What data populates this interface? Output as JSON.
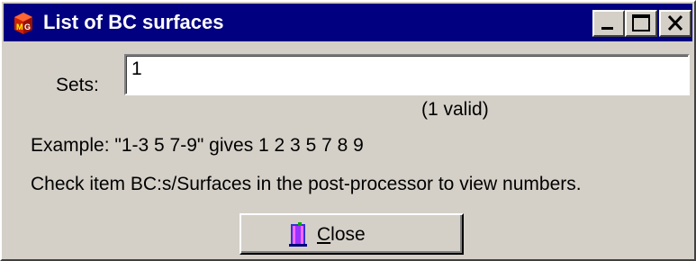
{
  "window": {
    "title": "List of BC surfaces"
  },
  "form": {
    "sets_label": "Sets:",
    "sets_value": "1",
    "valid_count": "(1 valid)",
    "example_text": "Example: \"1-3 5 7-9\" gives 1 2 3 5 7 8 9",
    "help_text": "Check item BC:s/Surfaces in the post-processor to view numbers."
  },
  "close_button": {
    "mnemonic": "C",
    "label_rest": "lose"
  },
  "icons": {
    "app": "app-logo-icon",
    "minimize": "minimize-icon",
    "maximize": "maximize-icon",
    "close": "close-icon",
    "door": "door-exit-icon"
  },
  "colors": {
    "titlebar": "#000080",
    "face": "#d4d0c8"
  }
}
